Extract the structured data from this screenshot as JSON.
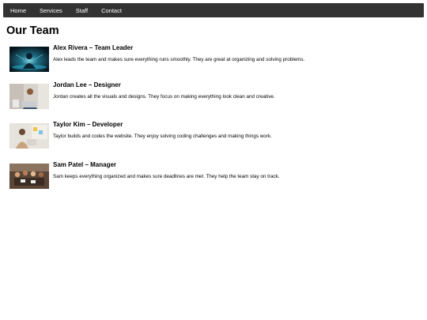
{
  "nav": {
    "links": [
      "Home",
      "Services",
      "Staff",
      "Contact"
    ]
  },
  "page": {
    "title": "Our Team"
  },
  "team": [
    {
      "name": "Alex Rivera – Team Leader",
      "bio": "Alex leads the team and makes sure everything runs smoothly. They are great at organizing and solving problems.",
      "photo": "abstract-tech-figure-image"
    },
    {
      "name": "Jordan Lee – Designer",
      "bio": "Jordan creates all the visuals and designs. They focus on making everything look clean and creative.",
      "photo": "person-at-laptop-image"
    },
    {
      "name": "Taylor Kim – Developer",
      "bio": "Taylor builds and codes the website. They enjoy solving coding challenges and making things work.",
      "photo": "person-with-board-image"
    },
    {
      "name": "Sam Patel – Manager",
      "bio": "Sam keeps everything organized and makes sure deadlines are met. They help the team stay on track.",
      "photo": "team-meeting-image"
    }
  ],
  "colors": {
    "navbar": "#333333",
    "nav_text": "#ffffff",
    "text": "#000000"
  }
}
